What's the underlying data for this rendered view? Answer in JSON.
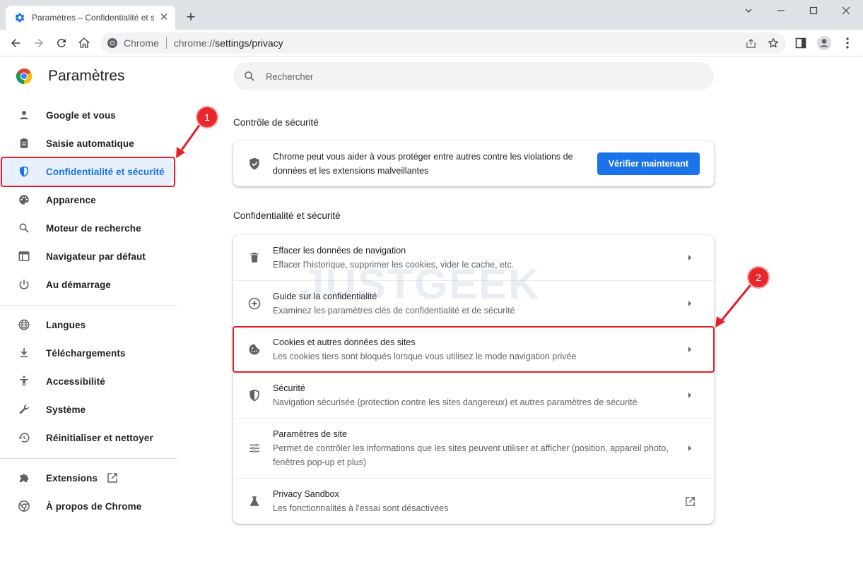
{
  "browser": {
    "tab_title": "Paramètres – Confidentialité et sé",
    "omnibox_chip": "Chrome",
    "url_scheme": "chrome://",
    "url_path": "settings/privacy"
  },
  "sidebar": {
    "title": "Paramètres",
    "items": [
      {
        "label": "Google et vous",
        "icon": "person-icon"
      },
      {
        "label": "Saisie automatique",
        "icon": "clipboard-icon"
      },
      {
        "label": "Confidentialité et sécurité",
        "icon": "shield-icon",
        "active": true
      },
      {
        "label": "Apparence",
        "icon": "palette-icon"
      },
      {
        "label": "Moteur de recherche",
        "icon": "search-icon"
      },
      {
        "label": "Navigateur par défaut",
        "icon": "browser-window-icon"
      },
      {
        "label": "Au démarrage",
        "icon": "power-icon"
      },
      {
        "label": "Langues",
        "icon": "globe-icon"
      },
      {
        "label": "Téléchargements",
        "icon": "download-icon"
      },
      {
        "label": "Accessibilité",
        "icon": "accessibility-icon"
      },
      {
        "label": "Système",
        "icon": "wrench-icon"
      },
      {
        "label": "Réinitialiser et nettoyer",
        "icon": "restore-icon"
      },
      {
        "label": "Extensions",
        "icon": "puzzle-icon"
      },
      {
        "label": "À propos de Chrome",
        "icon": "chrome-icon"
      }
    ]
  },
  "search": {
    "placeholder": "Rechercher"
  },
  "safety_check": {
    "section_title": "Contrôle de sécurité",
    "text": "Chrome peut vous aider à vous protéger entre autres contre les violations de données et les extensions malveillantes",
    "button_label": "Vérifier maintenant"
  },
  "privacy": {
    "section_title": "Confidentialité et sécurité",
    "rows": [
      {
        "title": "Effacer les données de navigation",
        "subtitle": "Effacer l'historique, supprimer les cookies, vider le cache, etc.",
        "icon": "trash-icon"
      },
      {
        "title": "Guide sur la confidentialité",
        "subtitle": "Examinez les paramètres clés de confidentialité et de sécurité",
        "icon": "compass-icon"
      },
      {
        "title": "Cookies et autres données des sites",
        "subtitle": "Les cookies tiers sont bloqués lorsque vous utilisez le mode navigation privée",
        "icon": "cookie-icon"
      },
      {
        "title": "Sécurité",
        "subtitle": "Navigation sécurisée (protection contre les sites dangereux) et autres paramètres de sécurité",
        "icon": "shield-outline-icon"
      },
      {
        "title": "Paramètres de site",
        "subtitle": "Permet de contrôler les informations que les sites peuvent utiliser et afficher (position, appareil photo, fenêtres pop-up et plus)",
        "icon": "tune-icon"
      },
      {
        "title": "Privacy Sandbox",
        "subtitle": "Les fonctionnalités à l'essai sont désactivées",
        "icon": "flask-icon"
      }
    ]
  },
  "annotations": {
    "badge_1": "1",
    "badge_2": "2",
    "watermark": "JUSTGEEK"
  },
  "colors": {
    "accent": "#1a73e8",
    "active_bg": "#e8f0fe",
    "annotation_red": "#e32029"
  }
}
